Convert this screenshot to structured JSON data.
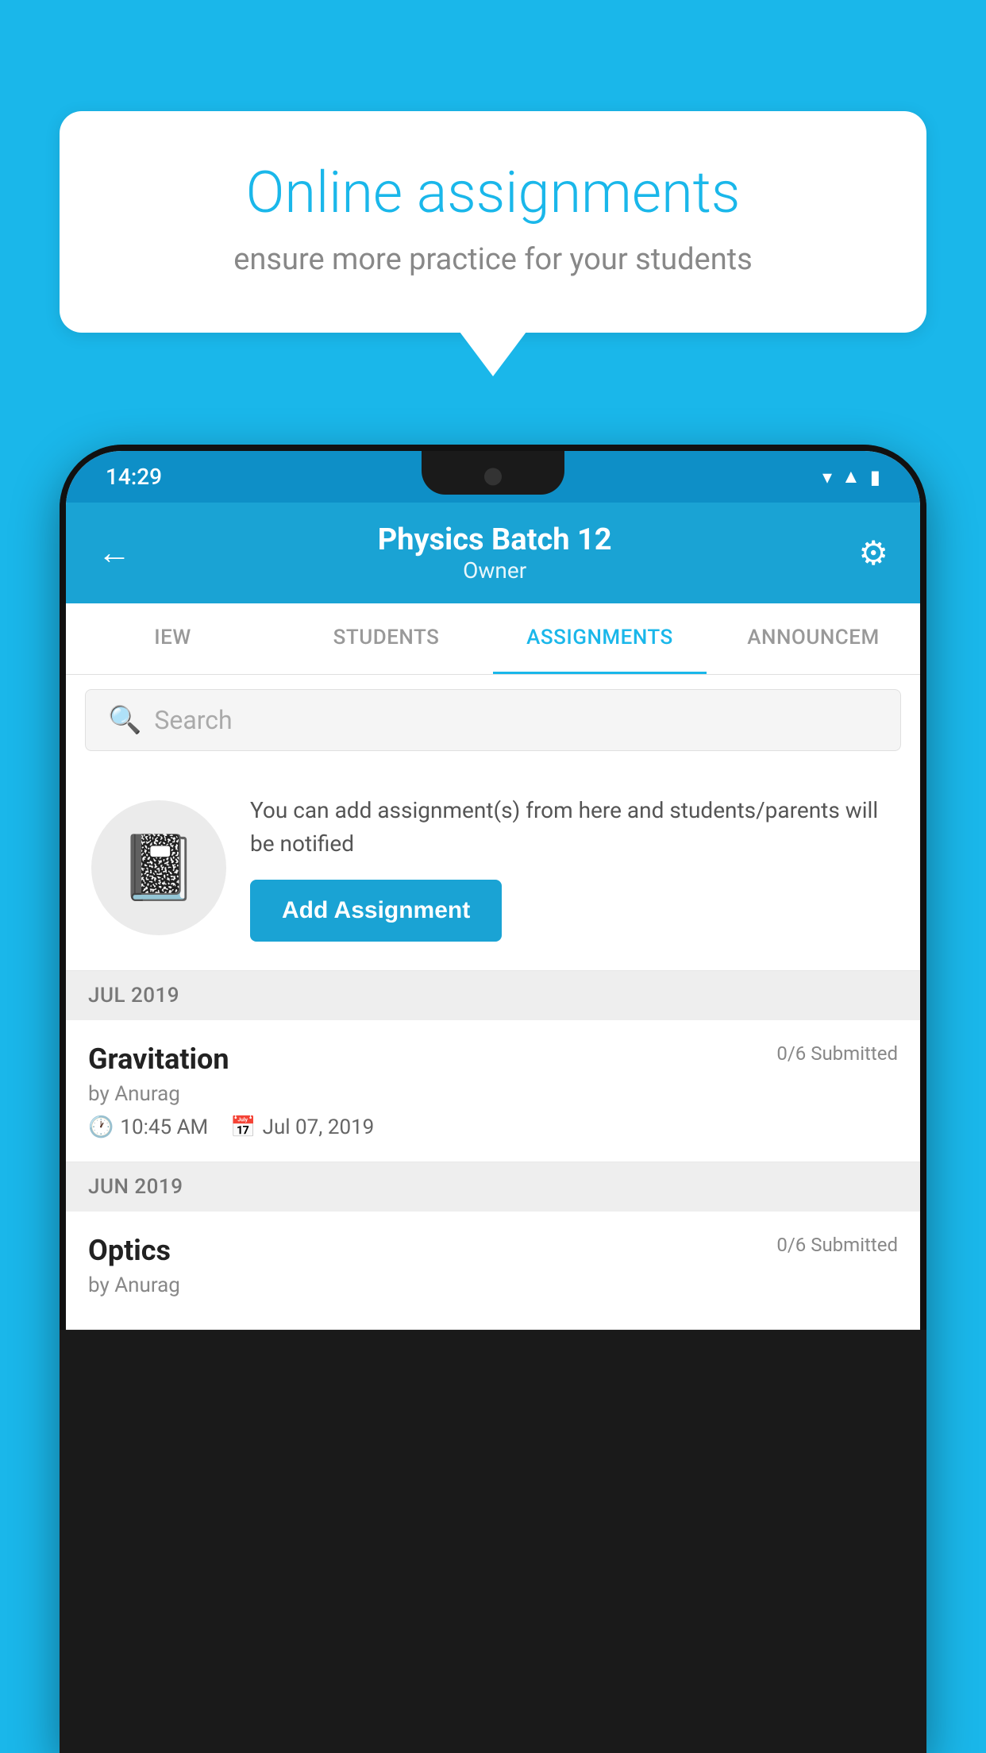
{
  "background_color": "#1ab7ea",
  "speech_bubble": {
    "title": "Online assignments",
    "subtitle": "ensure more practice for your students"
  },
  "phone": {
    "status_bar": {
      "time": "14:29",
      "icons": [
        "wifi",
        "signal",
        "battery"
      ]
    },
    "header": {
      "title": "Physics Batch 12",
      "subtitle": "Owner",
      "back_label": "←",
      "settings_label": "⚙"
    },
    "tabs": [
      {
        "label": "IEW",
        "active": false
      },
      {
        "label": "STUDENTS",
        "active": false
      },
      {
        "label": "ASSIGNMENTS",
        "active": true
      },
      {
        "label": "ANNOUNCEM",
        "active": false
      }
    ],
    "search": {
      "placeholder": "Search"
    },
    "promo": {
      "description": "You can add assignment(s) from here and students/parents will be notified",
      "button_label": "Add Assignment"
    },
    "sections": [
      {
        "month": "JUL 2019",
        "assignments": [
          {
            "name": "Gravitation",
            "submitted": "0/6 Submitted",
            "by": "by Anurag",
            "time": "10:45 AM",
            "date": "Jul 07, 2019"
          }
        ]
      },
      {
        "month": "JUN 2019",
        "assignments": [
          {
            "name": "Optics",
            "submitted": "0/6 Submitted",
            "by": "by Anurag",
            "time": "",
            "date": ""
          }
        ]
      }
    ]
  }
}
